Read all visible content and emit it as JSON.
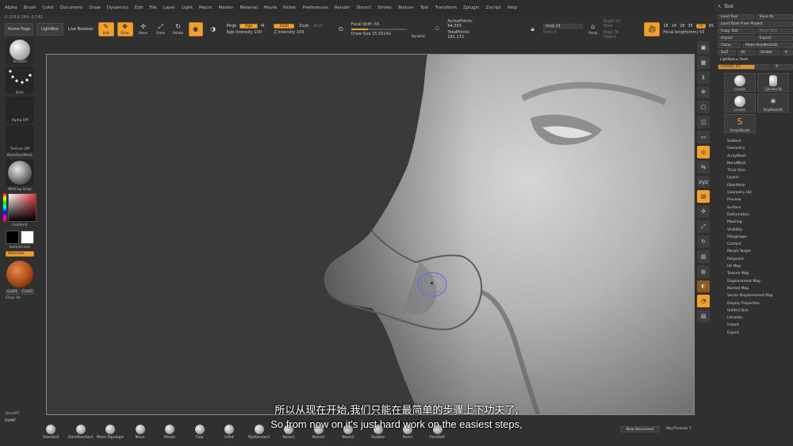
{
  "menu": [
    "Alpha",
    "Brush",
    "Color",
    "Document",
    "Draw",
    "Dynamics",
    "Edit",
    "File",
    "Layer",
    "Light",
    "Macro",
    "Marker",
    "Material",
    "Movie",
    "Picker",
    "Preferences",
    "Render",
    "Stencil",
    "Stroke",
    "Texture",
    "Tool",
    "Transform",
    "Zplugin",
    "Zscript",
    "Help"
  ],
  "coords": "0.118,0.284,-0.742",
  "shelf": {
    "home": "Home Page",
    "lightbox": "LightBox",
    "live_boolean": "Live Boolean",
    "edit": "Edit",
    "draw": "Draw",
    "move": "Move",
    "scale": "Scale",
    "rotate": "Rotate",
    "mrgb": "Mrgb",
    "rgb": "Rgb",
    "m": "M",
    "rgb_intensity": "Rgb Intensity 100",
    "zadd": "Zadd",
    "zsub": "Zsub",
    "zcut": "Zcut",
    "z_intensity": "Z Intensity 100",
    "focal_shift": "Focal Shift -55",
    "draw_size": "Draw Size 15.55142",
    "dynamic": "Dynamic",
    "active_points": "ActivePoints: 64,393",
    "total_points": "TotalPoints: 181,172",
    "undo": "Undo 14",
    "redo": "Redo 0",
    "persp": "Persp",
    "angle_of_view": "Angle Of View",
    "align_to_object": "Align To Object",
    "focal_values": [
      "18",
      "24",
      "28",
      "35",
      "50",
      "85"
    ],
    "focal_selected": "50",
    "focal_length": "Focal length(mm) 50"
  },
  "left": {
    "brush": "Smooth",
    "stroke": "Dots",
    "alpha": "Alpha Off",
    "texture": "Texture Off",
    "backface": "BackfaceMask",
    "material": "MatCap Gray",
    "gradient": "Gradient",
    "switch": "SwitchColor",
    "alternate": "Alternate",
    "cust1": "Cust1",
    "cust2": "Cust2",
    "clear": "Clear All",
    "store": "StoreMT",
    "delmt": "DelMT"
  },
  "vstrip": [
    "BPR",
    "SPix 3",
    "Scroll",
    "Zoom",
    "Actual",
    "AAHalf",
    "Floor",
    "Local",
    "L.Sym",
    "Xyz",
    "Frame",
    "Move",
    "Scale",
    "Rotate",
    "Line Fill PolyF",
    "Transp",
    "Dynamic",
    "Solo",
    "Xpose"
  ],
  "tool": {
    "title": "Tool",
    "load_tool": "Load Tool",
    "save_as": "Save As",
    "load_from_project": "Load Tools From Project",
    "copy_tool": "Copy Tool",
    "paste_tool": "Paste Tool",
    "import": "Import",
    "export": "Export",
    "clone": "Clone",
    "make_polymesh": "Make PolyMesh3D",
    "goz": "GoZ",
    "all": "All",
    "visible": "Visible",
    "r": "R",
    "lightbox_tools": "Lightbox ▸ Tools",
    "lincoln": "Lincoln: 41",
    "thumbs": [
      "Lincoln",
      "Cylinder3D",
      "Lincoln",
      "PolyMesh3D",
      "SimpleBrush"
    ],
    "subtools": [
      "Subtool",
      "Geometry",
      "ArrayMesh",
      "NanoMesh",
      "Thick Skin",
      "Layers",
      "FiberMesh",
      "Geometry HD",
      "Preview",
      "Surface",
      "Deformation",
      "Masking",
      "Visibility",
      "Polygroups",
      "Contact",
      "Morph Target",
      "Polypaint",
      "UV Map",
      "Texture Map",
      "Displacement Map",
      "Normal Map",
      "Vector Displacement Map",
      "Display Properties",
      "Unified Skin",
      "Initialize",
      "Import",
      "Export"
    ]
  },
  "brushes": [
    "Standard",
    "DamStandard",
    "Move Topologic",
    "Move",
    "Morph",
    "Clay",
    "Inflat",
    "MyStandard",
    "Noise1",
    "Noise2",
    "Noise3",
    "Stubble",
    "Pore1",
    "PoreSoft"
  ],
  "new_document": "New Document",
  "max_threads": "MaxThreads 7",
  "subtitle_cn": "所以从现在开始,我们只能在最简单的步骤上下功夫了,",
  "subtitle_en": "So from now on,it's just hard work on the easiest steps,"
}
